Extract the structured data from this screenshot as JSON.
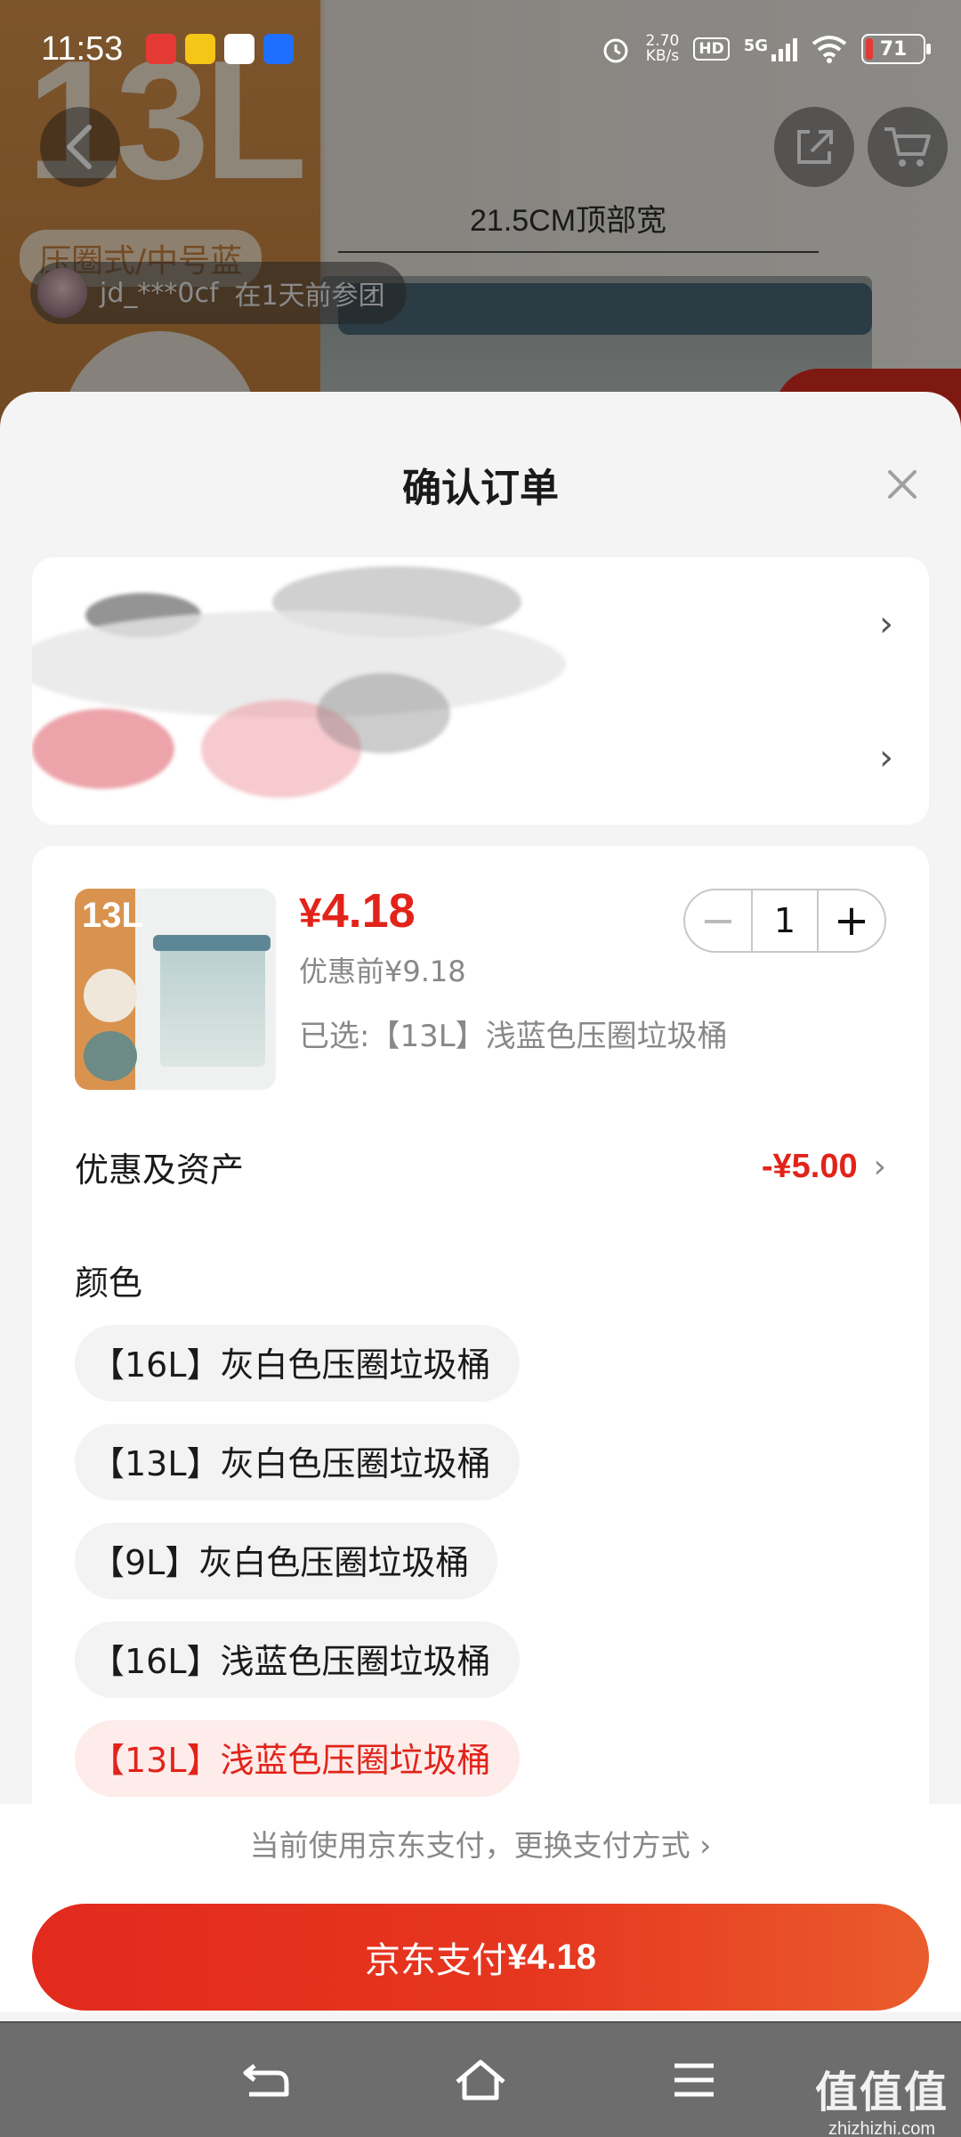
{
  "status_bar": {
    "time": "11:53",
    "net_speed_value": "2.70",
    "net_speed_unit": "KB/s",
    "hd": "HD",
    "network": "5G",
    "battery": "71"
  },
  "background": {
    "big_label": "13L",
    "tag": "压圈式/中号蓝",
    "dimension_label": "21.5CM顶部宽",
    "group_user": "jd_***0cf",
    "group_info": "在1天前参团"
  },
  "sheet": {
    "title": "确认订单",
    "close_icon": "close-icon"
  },
  "product": {
    "thumb_label": "13L",
    "price_symbol": "¥",
    "price": "4.18",
    "original_price": "优惠前¥9.18",
    "selected_spec": "已选:【13L】浅蓝色压圈垃圾桶",
    "quantity": "1",
    "minus": "−",
    "plus": "+"
  },
  "discount": {
    "label": "优惠及资产",
    "value": "-¥5.00"
  },
  "color": {
    "title": "颜色",
    "options": [
      "【16L】灰白色压圈垃圾桶",
      "【13L】灰白色压圈垃圾桶",
      "【9L】灰白色压圈垃圾桶",
      "【16L】浅蓝色压圈垃圾桶",
      "【13L】浅蓝色压圈垃圾桶"
    ],
    "selected_index": 4
  },
  "payment": {
    "method_text": "当前使用京东支付，更换支付方式",
    "button_prefix": "京东支付",
    "button_amount": "¥4.18"
  },
  "watermark": {
    "big": "值值值",
    "small": "zhizhizhi.com"
  },
  "colors": {
    "accent_red": "#e2231a",
    "selected_bg": "#fdecea"
  }
}
